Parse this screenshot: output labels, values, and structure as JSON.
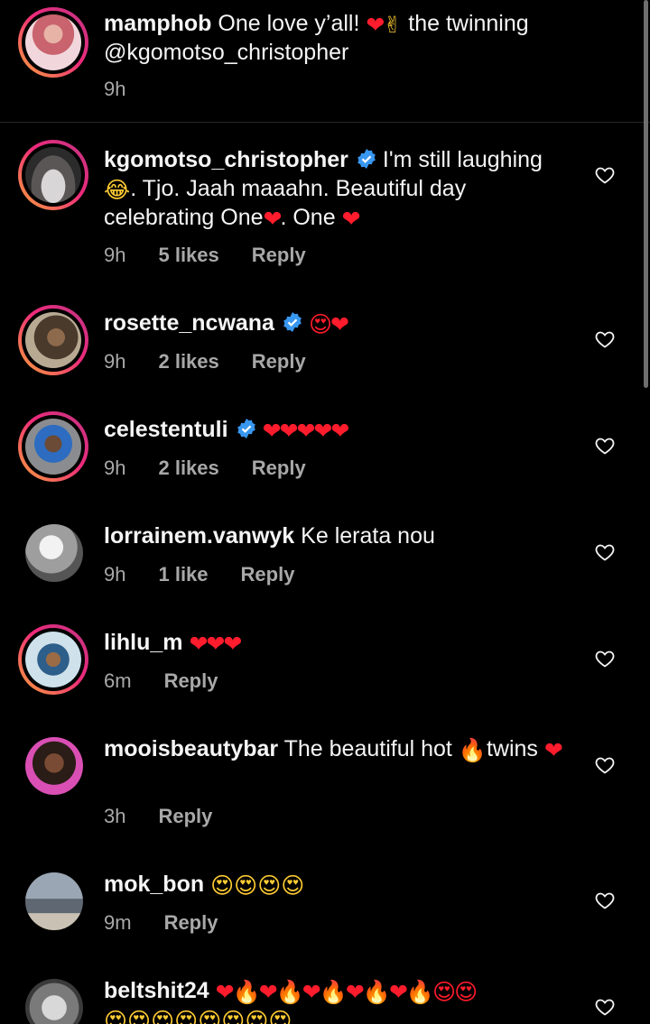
{
  "caption": {
    "username": "mamphob",
    "text_a": "One love y’all!",
    "heart": "❤",
    "victory": "✌",
    "text_b": "the twinning",
    "mention": "@kgomotso_christopher",
    "time": "9h"
  },
  "comments": [
    {
      "username": "kgomotso_christopher",
      "text_a": "I'm still laughing",
      "face": "😂",
      "text_b": ". Tjo. Jaah maaahn.  Beautiful day celebrating One",
      "heart_a": "❤",
      "text_c": ". One",
      "heart_b": "❤",
      "time": "9h",
      "likes": "5 likes",
      "reply": "Reply"
    },
    {
      "username": "rosette_ncwana",
      "emojis": "😍❤",
      "time": "9h",
      "likes": "2 likes",
      "reply": "Reply"
    },
    {
      "username": "celestentuli",
      "emojis": "❤❤❤❤❤",
      "time": "9h",
      "likes": "2 likes",
      "reply": "Reply"
    },
    {
      "username": "lorrainem.vanwyk",
      "text": "Ke lerata nou",
      "time": "9h",
      "likes": "1 like",
      "reply": "Reply"
    },
    {
      "username": "lihlu_m",
      "emojis": "❤❤❤",
      "time": "6m",
      "reply": "Reply"
    },
    {
      "username": "mooisbeautybar",
      "text_a": "The beautiful hot",
      "fire": "🔥",
      "text_b": "twins",
      "heart": "❤",
      "time": "3h",
      "reply": "Reply"
    },
    {
      "username": "mok_bon",
      "emojis": "😍😍😍😍",
      "time": "9m",
      "reply": "Reply"
    },
    {
      "username": "beltshit24",
      "emojis": "❤🔥❤🔥❤🔥❤🔥❤🔥😍😍",
      "emojis_line2": "😍😍😍😍😍😍😍😍"
    }
  ],
  "icons": {
    "heart_outline": "heart-outline-icon",
    "verified": "verified-badge-icon"
  },
  "colors": {
    "background": "#000000",
    "text": "#f5f5f5",
    "meta": "#a8a8a8",
    "verified": "#3897f0",
    "heart_emoji": "#ff1c2c"
  }
}
